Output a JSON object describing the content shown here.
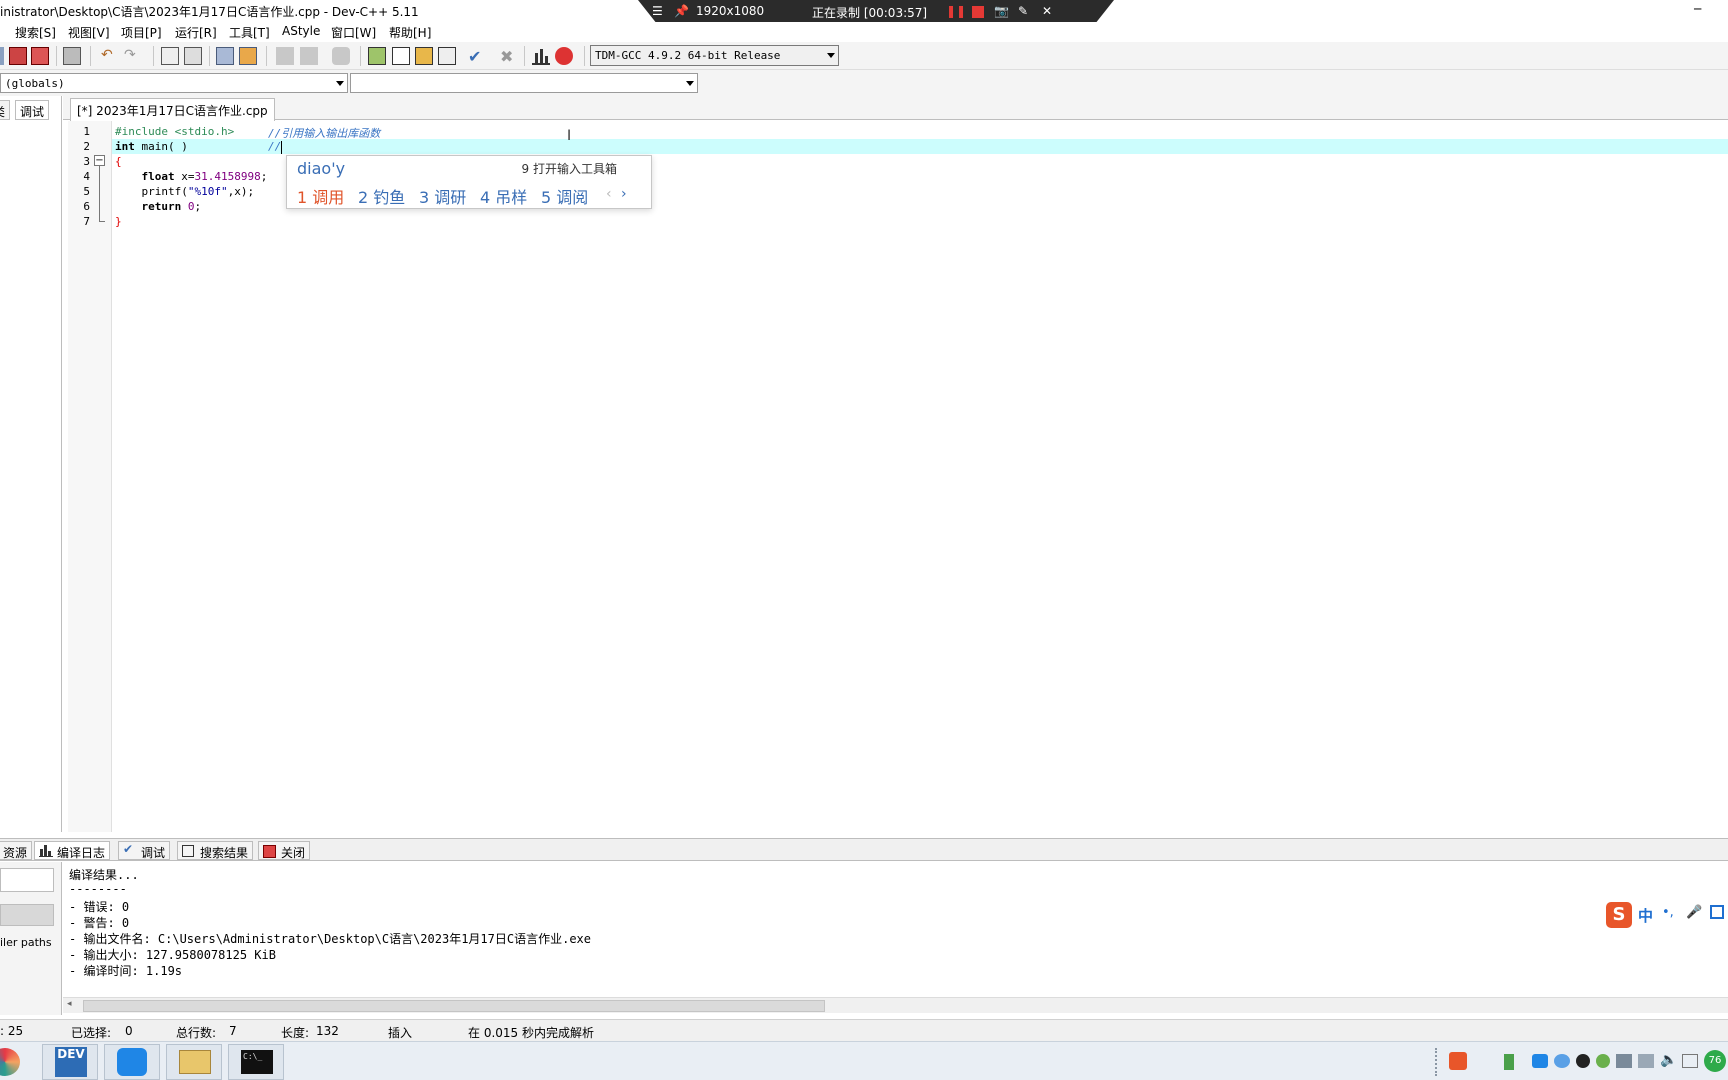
{
  "window": {
    "title": "inistrator\\Desktop\\C语言\\2023年1月17日C语言作业.cpp - Dev-C++ 5.11"
  },
  "recorder": {
    "resolution": "1920x1080",
    "status": "正在录制 [00:03:57]"
  },
  "menu": [
    "搜索[S]",
    "视图[V]",
    "项目[P]",
    "运行[R]",
    "工具[T]",
    "AStyle",
    "窗口[W]",
    "帮助[H]"
  ],
  "toolbar": {
    "compiler": "TDM-GCC 4.9.2 64-bit Release",
    "scope": "(globals)",
    "symbol": ""
  },
  "left_tabs": [
    "类",
    "调试"
  ],
  "editor": {
    "tab_label": "[*] 2023年1月17日C语言作业.cpp",
    "line_numbers": [
      "1",
      "2",
      "3",
      "4",
      "5",
      "6",
      "7"
    ]
  },
  "code": {
    "l1_include": "#include <stdio.h>",
    "l1_comment": "//引用输入输出库函数",
    "l2_int": "int",
    "l2_main": " main( )",
    "l2_comment": "//",
    "l3_brace": "{",
    "l4_float": "    float",
    "l4_var": " x=",
    "l4_num": "31.4158998",
    "l4_semi": ";",
    "l5_printf": "    printf(",
    "l5_str": "\"%10f\"",
    "l5_rest": ",x);",
    "l6_return": "    return",
    "l6_num": " 0",
    "l6_semi": ";",
    "l7_brace": "}"
  },
  "ime_popup": {
    "pinyin": "diao'y",
    "toolbox": "9 打开输入工具箱",
    "candidates": [
      "1 调用",
      "2 钓鱼",
      "3 调研",
      "4 吊样",
      "5 调阅"
    ],
    "prev": "‹",
    "next": "›"
  },
  "bottom_tabs": [
    "资源",
    "编译日志",
    "调试",
    "搜索结果",
    "关闭"
  ],
  "log_left_label": "iler paths",
  "log": [
    "编译结果...",
    "--------",
    "- 错误: 0",
    "- 警告: 0",
    "- 输出文件名: C:\\Users\\Administrator\\Desktop\\C语言\\2023年1月17日C语言作业.exe",
    "- 输出大小: 127.9580078125 KiB",
    "- 编译时间: 1.19s"
  ],
  "status": {
    "col": ": 25",
    "selected_label": "已选择:",
    "selected": "0",
    "lines_label": "总行数:",
    "lines": "7",
    "length_label": "长度:",
    "length": "132",
    "mode": "插入",
    "parse": "在 0.015 秒内完成解析"
  },
  "ime_bar": {
    "lang": "中",
    "punct": "•,",
    "mic": "🎤"
  },
  "taskbar": {
    "dev_label": "DEV",
    "cmd_label": "C:\\_",
    "battery": "76"
  }
}
